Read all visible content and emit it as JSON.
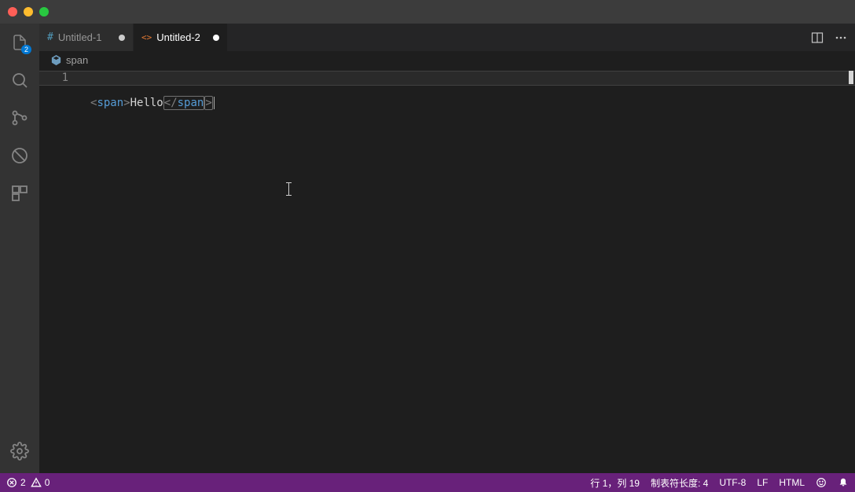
{
  "activity_bar": {
    "explorer_badge": "2"
  },
  "tabs": [
    {
      "label": "Untitled-1",
      "file_icon": "#",
      "dirty": true,
      "active": false
    },
    {
      "label": "Untitled-2",
      "file_icon": "<>",
      "dirty": true,
      "active": true
    }
  ],
  "breadcrumb": {
    "label": "span"
  },
  "editor": {
    "line_number": "1",
    "code": {
      "open_lt": "<",
      "open_tag": "span",
      "open_gt": ">",
      "text": "Hello",
      "close_lt": "<",
      "close_slash": "/",
      "close_tag": "span",
      "close_gt": ">"
    }
  },
  "status_bar": {
    "errors": "2",
    "warnings": "0",
    "cursor": "行 1，列 19",
    "tab_size": "制表符长度: 4",
    "encoding": "UTF-8",
    "eol": "LF",
    "language": "HTML"
  }
}
